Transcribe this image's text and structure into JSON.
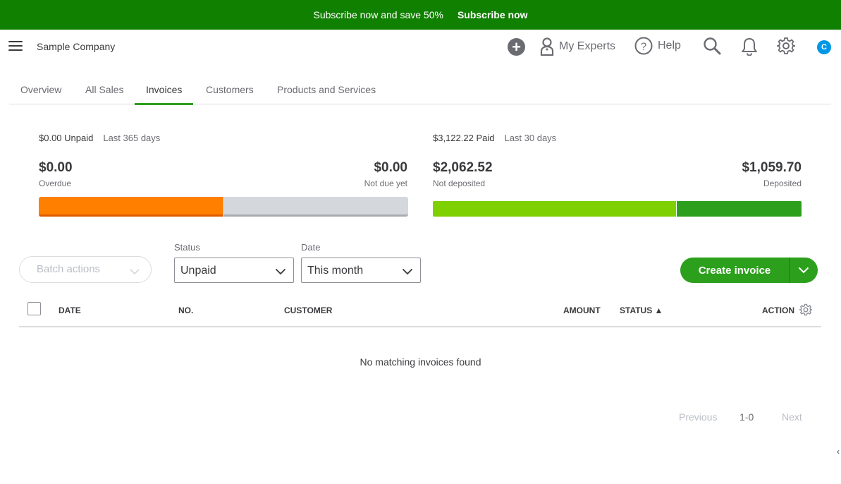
{
  "promo": {
    "text": "Subscribe now and save 50%",
    "cta": "Subscribe now"
  },
  "header": {
    "company": "Sample Company",
    "my_experts": "My Experts",
    "help": "Help",
    "avatar_initial": "C"
  },
  "tabs": [
    {
      "label": "Overview"
    },
    {
      "label": "All Sales"
    },
    {
      "label": "Invoices",
      "active": true
    },
    {
      "label": "Customers"
    },
    {
      "label": "Products and Services"
    }
  ],
  "unpaid": {
    "title": "$0.00 Unpaid",
    "period": "Last 365 days",
    "overdue_amount": "$0.00",
    "overdue_label": "Overdue",
    "not_due_amount": "$0.00",
    "not_due_label": "Not due yet"
  },
  "paid": {
    "title": "$3,122.22 Paid",
    "period": "Last 30 days",
    "not_deposited_amount": "$2,062.52",
    "not_deposited_label": "Not deposited",
    "deposited_amount": "$1,059.70",
    "deposited_label": "Deposited"
  },
  "colors": {
    "brand_green": "#2ca01c",
    "promo_green": "#108000",
    "overdue_orange": "#ff8000",
    "not_due_gray": "#d4d7dc",
    "not_deposited_green": "#7fd000",
    "deposited_green": "#2ca01c"
  },
  "filters": {
    "batch_actions": "Batch actions",
    "status_label": "Status",
    "status_value": "Unpaid",
    "date_label": "Date",
    "date_value": "This month"
  },
  "create_invoice": "Create invoice",
  "table": {
    "columns": [
      "DATE",
      "NO.",
      "CUSTOMER",
      "AMOUNT",
      "STATUS ▲",
      "ACTION"
    ],
    "empty_message": "No matching invoices found"
  },
  "pagination": {
    "previous": "Previous",
    "range": "1-0",
    "next": "Next"
  },
  "icons": {
    "menu": "hamburger-icon",
    "add": "plus-icon",
    "experts": "person-icon",
    "help": "question-icon",
    "search": "search-icon",
    "notifications": "bell-icon",
    "settings": "gear-icon",
    "dropdown": "chevron-down-icon",
    "collapse": "chevron-left-icon"
  }
}
